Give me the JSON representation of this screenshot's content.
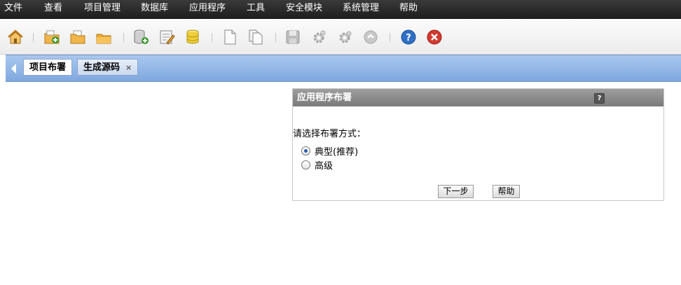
{
  "menu": [
    "文件",
    "查看",
    "项目管理",
    "数据库",
    "应用程序",
    "工具",
    "安全模块",
    "系统管理",
    "帮助"
  ],
  "toolbar": {
    "icons": [
      "home-icon",
      "folder-add-icon",
      "folder-open-icon",
      "folder-icon",
      "database-add-icon",
      "database-edit-icon",
      "database-icon",
      "page-icon",
      "pages-icon",
      "save-icon",
      "gear-icon",
      "gear-settings-icon",
      "refresh-icon",
      "help-icon",
      "close-icon"
    ]
  },
  "tabs": [
    {
      "label": "项目布署",
      "active": true
    },
    {
      "label": "生成源码",
      "active": false,
      "close": "×"
    }
  ],
  "panel": {
    "title": "应用程序布署",
    "help": "?",
    "prompt": "请选择布署方式：",
    "options": [
      {
        "label": "典型(推荐)",
        "checked": true
      },
      {
        "label": "高级",
        "checked": false
      }
    ],
    "next_button": "下一步",
    "help_button": "帮助"
  },
  "colors": {
    "menubar": "#2a2a2a",
    "tabbar": "#8fb3e6",
    "panel_header": "#8a8a8a"
  }
}
